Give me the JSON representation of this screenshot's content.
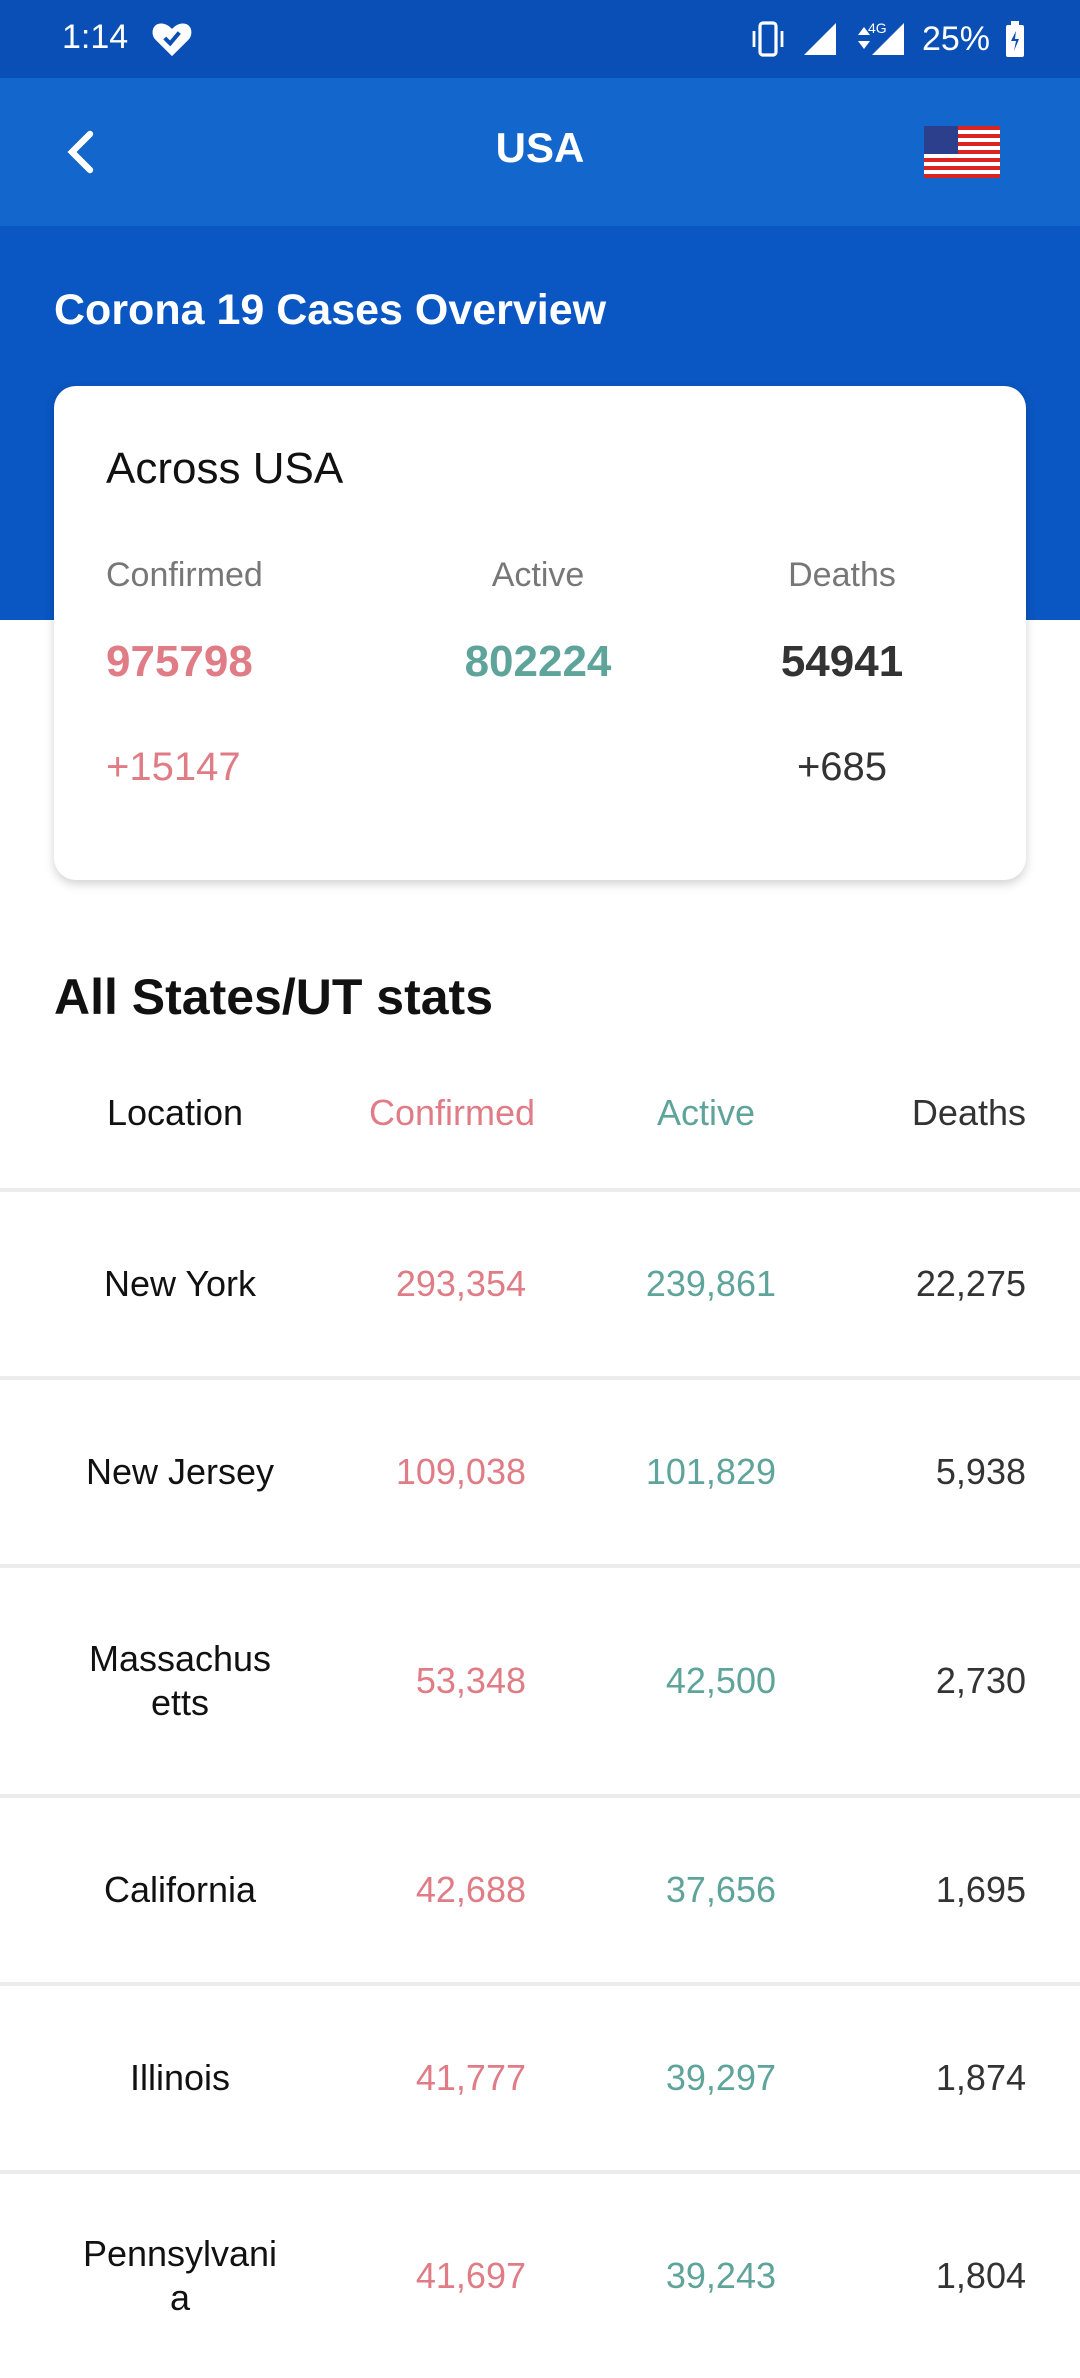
{
  "status_bar": {
    "time": "1:14",
    "battery": "25%",
    "network": "4G"
  },
  "app_bar": {
    "title": "USA"
  },
  "header": {
    "overview_title": "Corona 19 Cases Overview"
  },
  "summary_card": {
    "title": "Across USA",
    "confirmed_label": "Confirmed",
    "active_label": "Active",
    "deaths_label": "Deaths",
    "confirmed": "975798",
    "active": "802224",
    "deaths": "54941",
    "confirmed_delta": "+15147",
    "deaths_delta": "+685"
  },
  "states": {
    "title": "All States/UT stats",
    "headers": {
      "location": "Location",
      "confirmed": "Confirmed",
      "active": "Active",
      "deaths": "Deaths"
    },
    "rows": [
      {
        "location": "New York",
        "confirmed": "293,354",
        "active": "239,861",
        "deaths": "22,275"
      },
      {
        "location": "New Jersey",
        "confirmed": "109,038",
        "active": "101,829",
        "deaths": "5,938"
      },
      {
        "location": "Massachusetts",
        "confirmed": "53,348",
        "active": "42,500",
        "deaths": "2,730"
      },
      {
        "location": "California",
        "confirmed": "42,688",
        "active": "37,656",
        "deaths": "1,695"
      },
      {
        "location": "Illinois",
        "confirmed": "41,777",
        "active": "39,297",
        "deaths": "1,874"
      },
      {
        "location": "Pennsylvania",
        "confirmed": "41,697",
        "active": "39,243",
        "deaths": "1,804"
      }
    ]
  },
  "colors": {
    "primary": "#1366cb",
    "band": "#0a56c2",
    "confirmed": "#e07c86",
    "active": "#5fa49a"
  },
  "icons": {
    "back": "arrow-back-icon",
    "flag": "us-flag-icon",
    "heart": "heart-check-icon"
  }
}
